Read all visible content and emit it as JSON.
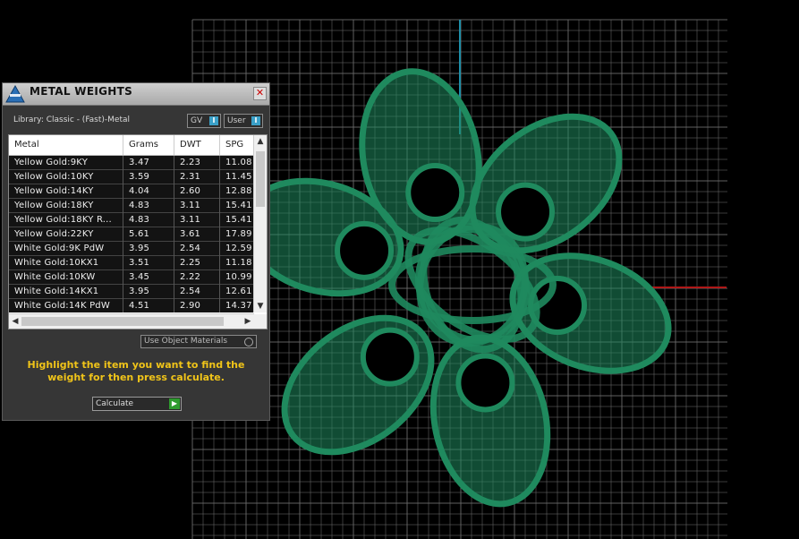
{
  "panel": {
    "title": "METAL WEIGHTS",
    "close_symbol": "✕",
    "library_label": "Library: Classic - (Fast)-Metal",
    "gv_label": "GV",
    "user_label": "User",
    "toggle_indicator": "I",
    "columns": {
      "metal": "Metal",
      "grams": "Grams",
      "dwt": "DWT",
      "spg": "SPG"
    },
    "rows": [
      {
        "metal": "Yellow Gold:9KY",
        "grams": "3.47",
        "dwt": "2.23",
        "spg": "11.08"
      },
      {
        "metal": "Yellow Gold:10KY",
        "grams": "3.59",
        "dwt": "2.31",
        "spg": "11.45"
      },
      {
        "metal": "Yellow Gold:14KY",
        "grams": "4.04",
        "dwt": "2.60",
        "spg": "12.88"
      },
      {
        "metal": "Yellow Gold:18KY",
        "grams": "4.83",
        "dwt": "3.11",
        "spg": "15.41"
      },
      {
        "metal": "Yellow Gold:18KY R...",
        "grams": "4.83",
        "dwt": "3.11",
        "spg": "15.41"
      },
      {
        "metal": "Yellow Gold:22KY",
        "grams": "5.61",
        "dwt": "3.61",
        "spg": "17.89"
      },
      {
        "metal": "White Gold:9K PdW",
        "grams": "3.95",
        "dwt": "2.54",
        "spg": "12.59"
      },
      {
        "metal": "White Gold:10KX1",
        "grams": "3.51",
        "dwt": "2.25",
        "spg": "11.18"
      },
      {
        "metal": "White Gold:10KW",
        "grams": "3.45",
        "dwt": "2.22",
        "spg": "10.99"
      },
      {
        "metal": "White Gold:14KX1",
        "grams": "3.95",
        "dwt": "2.54",
        "spg": "12.61"
      },
      {
        "metal": "White Gold:14K PdW",
        "grams": "4.51",
        "dwt": "2.90",
        "spg": "14.37"
      }
    ],
    "use_object_materials": "Use Object Materials",
    "instruction": "Highlight the item you want to find the weight for then press calculate.",
    "calculate_label": "Calculate"
  },
  "colors": {
    "model": "#1f8a5e",
    "grid": "#6b6b6b",
    "axis_y": "#1e8fa8",
    "axis_x": "#b01818",
    "instruction": "#f0c419"
  }
}
